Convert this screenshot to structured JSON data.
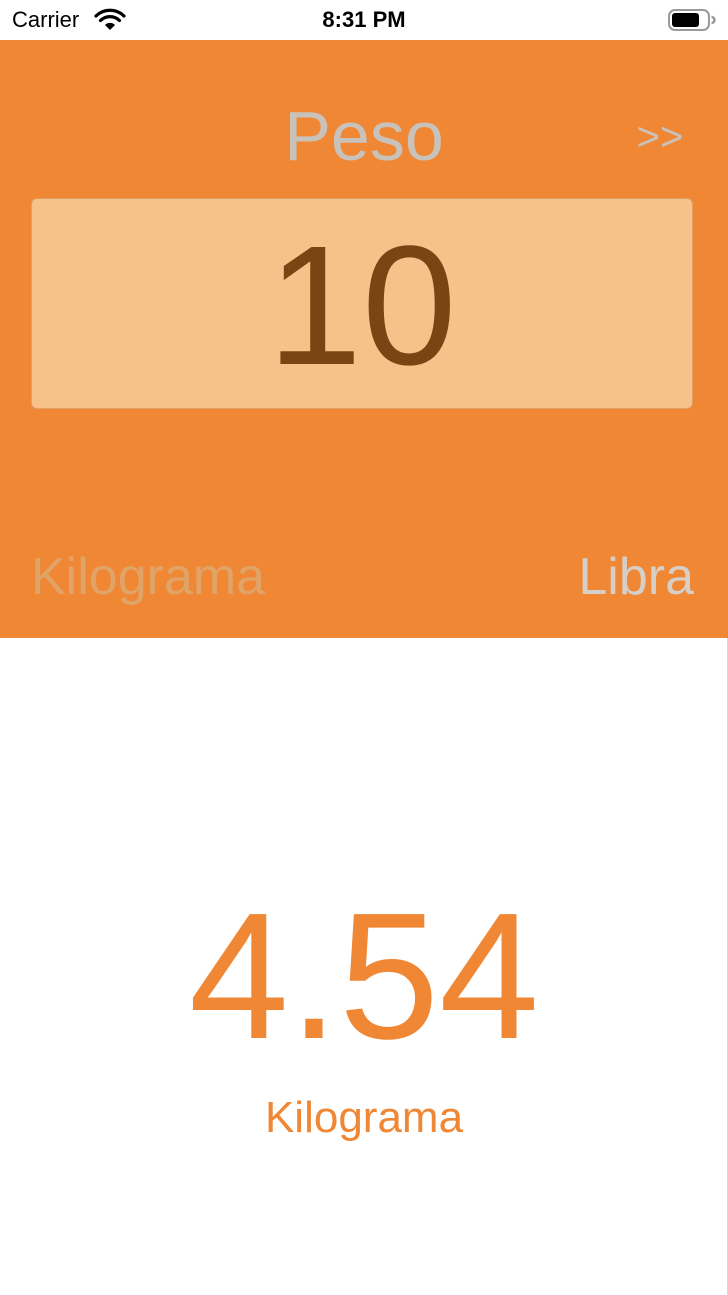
{
  "status_bar": {
    "carrier": "Carrier",
    "time": "8:31 PM",
    "wifi_icon": "wifi-icon",
    "battery_icon": "battery-icon"
  },
  "header": {
    "title": "Peso",
    "next_label": ">>"
  },
  "input": {
    "value": "10"
  },
  "units": {
    "from": "Kilograma",
    "to": "Libra"
  },
  "result": {
    "value": "4.54",
    "unit": "Kilograma"
  },
  "colors": {
    "accent": "#ef8735",
    "input_bg": "#f7c289",
    "input_text": "#7b4413",
    "muted": "#c9c2bb"
  }
}
